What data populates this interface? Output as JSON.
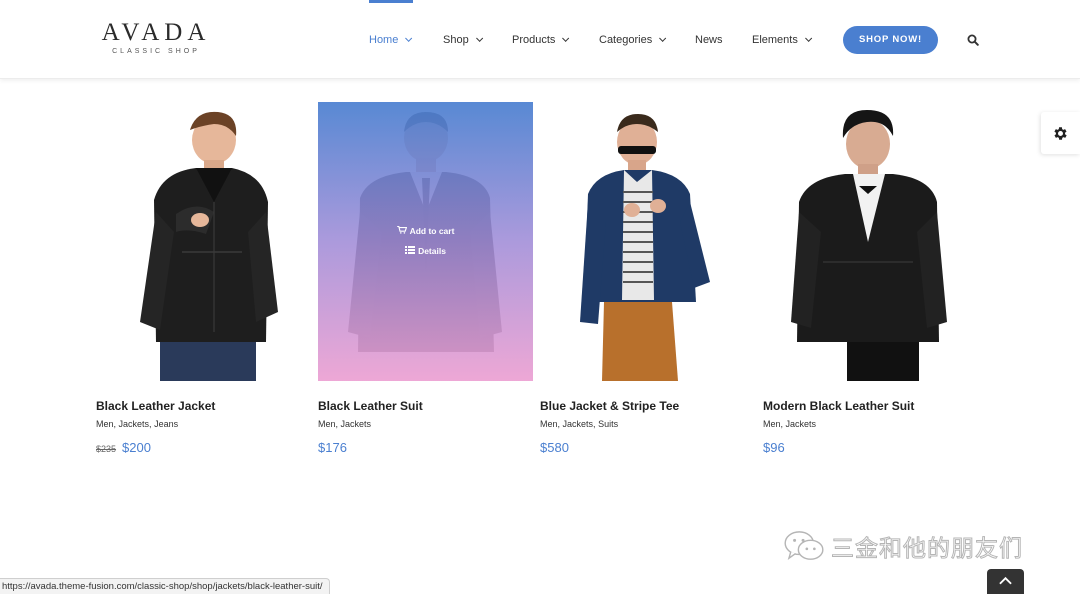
{
  "brand": {
    "logo_main": "AVADA",
    "logo_sub": "CLASSIC SHOP"
  },
  "nav": {
    "items": [
      {
        "label": "Home",
        "has_dropdown": true,
        "active": true
      },
      {
        "label": "Shop",
        "has_dropdown": true,
        "active": false
      },
      {
        "label": "Products",
        "has_dropdown": true,
        "active": false
      },
      {
        "label": "Categories",
        "has_dropdown": true,
        "active": false
      },
      {
        "label": "News",
        "has_dropdown": false,
        "active": false
      },
      {
        "label": "Elements",
        "has_dropdown": true,
        "active": false
      }
    ],
    "cta_label": "SHOP NOW!",
    "search_icon": "search-icon"
  },
  "colors": {
    "accent": "#4a7fd0",
    "overlay_top": "#4a7fd0",
    "overlay_bottom": "#eca0d2",
    "title_text": "#222222",
    "dark_button": "#333333"
  },
  "products": [
    {
      "title": "Black Leather Jacket",
      "categories": [
        "Men",
        "Jackets",
        "Jeans"
      ],
      "old_price": "$235",
      "price": "$200",
      "hovered": false
    },
    {
      "title": "Black Leather Suit",
      "categories": [
        "Men",
        "Jackets"
      ],
      "old_price": "",
      "price": "$176",
      "hovered": true
    },
    {
      "title": "Blue Jacket & Stripe Tee",
      "categories": [
        "Men",
        "Jackets",
        "Suits"
      ],
      "old_price": "",
      "price": "$580",
      "hovered": false
    },
    {
      "title": "Modern Black Leather Suit",
      "categories": [
        "Men",
        "Jackets"
      ],
      "old_price": "",
      "price": "$96",
      "hovered": false
    }
  ],
  "hover_actions": {
    "add_to_cart": "Add to cart",
    "details": "Details"
  },
  "watermark": {
    "text": "三金和他的朋友们",
    "icon": "wechat-icon"
  },
  "status_bar": {
    "url": "https://avada.theme-fusion.com/classic-shop/shop/jackets/black-leather-suit/"
  },
  "widgets": {
    "side_panel_icon": "gear-icon",
    "scroll_top_icon": "chevron-up-icon"
  }
}
